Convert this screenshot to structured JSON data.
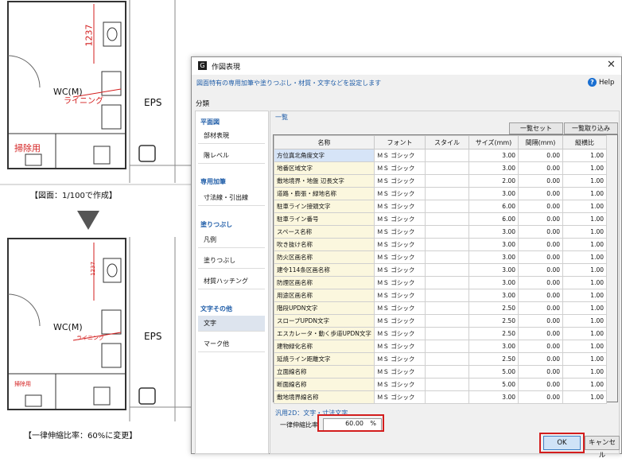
{
  "drawing": {
    "top": {
      "dim": "1237",
      "room": "WC(M)",
      "lining": "ライニング",
      "eps": "EPS",
      "cleaning": "掃除用"
    },
    "caption1": "【図面：1/100で作成】",
    "bottom": {
      "dim": "1237",
      "room": "WC(M)",
      "lining": "ライニング",
      "eps": "EPS",
      "cleaning": "掃除用"
    },
    "caption2": "【一律伸縮比率：60%に変更】"
  },
  "dialog": {
    "title": "作図表現",
    "description": "図面特有の専用加筆や塗りつぶし・材質・文字などを設定します",
    "help_label": "Help",
    "category_label": "分類",
    "sidebar": [
      {
        "type": "header",
        "label": "平面図"
      },
      {
        "type": "item",
        "label": "部材表現"
      },
      {
        "type": "item",
        "label": "階レベル"
      },
      {
        "type": "header",
        "label": "専用加筆"
      },
      {
        "type": "item",
        "label": "寸法線・引出線"
      },
      {
        "type": "header",
        "label": "塗りつぶし"
      },
      {
        "type": "item",
        "label": "凡例"
      },
      {
        "type": "item",
        "label": "塗りつぶし"
      },
      {
        "type": "item",
        "label": "材質ハッチング"
      },
      {
        "type": "header",
        "label": "文字その他"
      },
      {
        "type": "item",
        "label": "文字",
        "selected": true
      },
      {
        "type": "item",
        "label": "マーク他"
      }
    ],
    "list_group_label": "一覧",
    "list_set_button": "一覧セット",
    "list_import_button": "一覧取り込み",
    "columns": [
      "名称",
      "フォント",
      "スタイル",
      "サイズ(mm)",
      "間隔(mm)",
      "縦横比"
    ],
    "rows": [
      [
        "方位真北角度文字",
        "ＭＳ ゴシック",
        "",
        "3.00",
        "0.00",
        "1.00"
      ],
      [
        "地番区域文字",
        "ＭＳ ゴシック",
        "",
        "3.00",
        "0.00",
        "1.00"
      ],
      [
        "敷地境界・地盤 辺長文字",
        "ＭＳ ゴシック",
        "",
        "2.00",
        "0.00",
        "1.00"
      ],
      [
        "道路・膨張・緑地名称",
        "ＭＳ ゴシック",
        "",
        "3.00",
        "0.00",
        "1.00"
      ],
      [
        "駐車ライン接頭文字",
        "ＭＳ ゴシック",
        "",
        "6.00",
        "0.00",
        "1.00"
      ],
      [
        "駐車ライン番号",
        "ＭＳ ゴシック",
        "",
        "6.00",
        "0.00",
        "1.00"
      ],
      [
        "スペース名称",
        "ＭＳ ゴシック",
        "",
        "3.00",
        "0.00",
        "1.00"
      ],
      [
        "吹き抜け名称",
        "ＭＳ ゴシック",
        "",
        "3.00",
        "0.00",
        "1.00"
      ],
      [
        "防火区画名称",
        "ＭＳ ゴシック",
        "",
        "3.00",
        "0.00",
        "1.00"
      ],
      [
        "建令114条区画名称",
        "ＭＳ ゴシック",
        "",
        "3.00",
        "0.00",
        "1.00"
      ],
      [
        "防煙区画名称",
        "ＭＳ ゴシック",
        "",
        "3.00",
        "0.00",
        "1.00"
      ],
      [
        "用途区画名称",
        "ＭＳ ゴシック",
        "",
        "3.00",
        "0.00",
        "1.00"
      ],
      [
        "階段UPDN文字",
        "ＭＳ ゴシック",
        "",
        "2.50",
        "0.00",
        "1.00"
      ],
      [
        "スロープUPDN文字",
        "ＭＳ ゴシック",
        "",
        "2.50",
        "0.00",
        "1.00"
      ],
      [
        "エスカレータ・動く歩道UPDN文字",
        "ＭＳ ゴシック",
        "",
        "2.50",
        "0.00",
        "1.00"
      ],
      [
        "建物緑化名称",
        "ＭＳ ゴシック",
        "",
        "3.00",
        "0.00",
        "1.00"
      ],
      [
        "延焼ライン距離文字",
        "ＭＳ ゴシック",
        "",
        "2.50",
        "0.00",
        "1.00"
      ],
      [
        "立面線名称",
        "ＭＳ ゴシック",
        "",
        "5.00",
        "0.00",
        "1.00"
      ],
      [
        "断面線名称",
        "ＭＳ ゴシック",
        "",
        "5.00",
        "0.00",
        "1.00"
      ],
      [
        "敷地境界線名称",
        "ＭＳ ゴシック",
        "",
        "3.00",
        "0.00",
        "1.00"
      ]
    ],
    "hint_label": "汎用2D：文字・寸法文字",
    "ratio_label": "一律伸縮比率",
    "ratio_value": "60.00",
    "ratio_unit": "%",
    "ok_label": "OK",
    "cancel_label": "キャンセル",
    "colors": {
      "accent": "#1f5da8",
      "highlight": "#d31d1d",
      "name_cell": "#fbf7de"
    }
  }
}
